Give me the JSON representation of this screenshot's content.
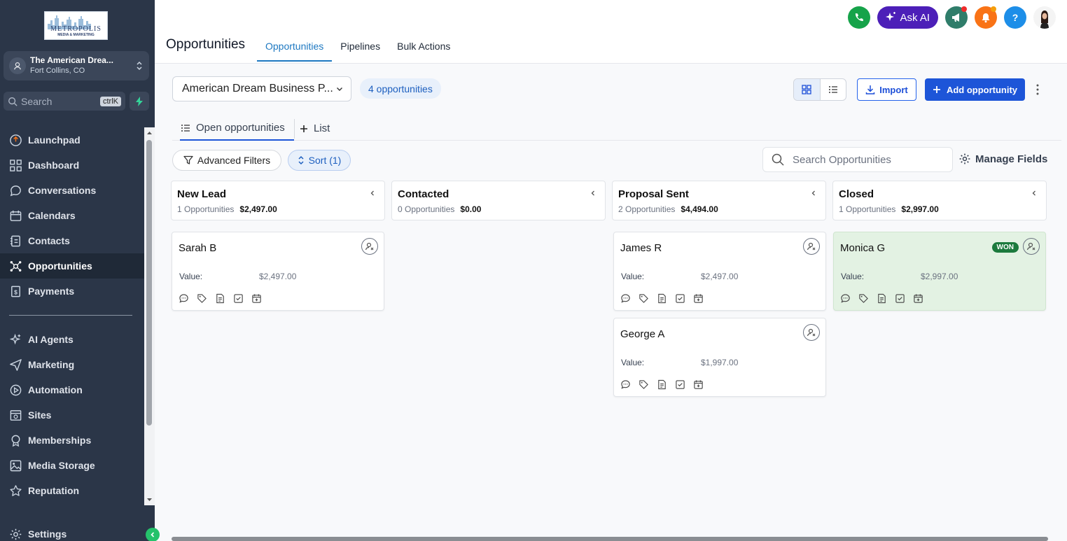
{
  "logo": {
    "line1": "METROPOLIS",
    "line2": "MEDIA & MARKETING"
  },
  "account": {
    "name": "The American Drea...",
    "location": "Fort Collins, CO"
  },
  "sidebar_search": {
    "placeholder": "Search",
    "shortcut": "ctrlK"
  },
  "nav": {
    "items": [
      {
        "label": "Launchpad",
        "icon": "launchpad-icon"
      },
      {
        "label": "Dashboard",
        "icon": "dashboard-icon"
      },
      {
        "label": "Conversations",
        "icon": "chat-icon"
      },
      {
        "label": "Calendars",
        "icon": "calendar-icon"
      },
      {
        "label": "Contacts",
        "icon": "contacts-icon"
      },
      {
        "label": "Opportunities",
        "icon": "opportunities-icon",
        "active": true
      },
      {
        "label": "Payments",
        "icon": "payments-icon"
      }
    ],
    "items2": [
      {
        "label": "AI Agents",
        "icon": "sparkle-icon"
      },
      {
        "label": "Marketing",
        "icon": "send-icon"
      },
      {
        "label": "Automation",
        "icon": "automation-icon"
      },
      {
        "label": "Sites",
        "icon": "sites-icon"
      },
      {
        "label": "Memberships",
        "icon": "badge-icon"
      },
      {
        "label": "Media Storage",
        "icon": "image-icon"
      },
      {
        "label": "Reputation",
        "icon": "star-icon"
      }
    ],
    "settings": "Settings"
  },
  "header": {
    "title": "Opportunities",
    "tabs": [
      "Opportunities",
      "Pipelines",
      "Bulk Actions"
    ],
    "ask_ai": "Ask AI"
  },
  "toolbar": {
    "pipeline": "American Dream Business P...",
    "count": "4 opportunities",
    "import": "Import",
    "add": "Add opportunity"
  },
  "subtabs": {
    "open": "Open opportunities",
    "list": "List"
  },
  "filters": {
    "advanced": "Advanced Filters",
    "sort": "Sort (1)",
    "search_placeholder": "Search Opportunities",
    "manage_fields": "Manage Fields"
  },
  "columns": [
    {
      "title": "New Lead",
      "count": "1 Opportunities",
      "total": "$2,497.00"
    },
    {
      "title": "Contacted",
      "count": "0 Opportunities",
      "total": "$0.00"
    },
    {
      "title": "Proposal Sent",
      "count": "2 Opportunities",
      "total": "$4,494.00"
    },
    {
      "title": "Closed",
      "count": "1 Opportunities",
      "total": "$2,997.00"
    }
  ],
  "cards": [
    {
      "name": "Sarah B",
      "value_label": "Value:",
      "value": "$2,497.00"
    },
    {
      "name": "James R",
      "value_label": "Value:",
      "value": "$2,497.00"
    },
    {
      "name": "George A",
      "value_label": "Value:",
      "value": "$1,997.00"
    },
    {
      "name": "Monica G",
      "value_label": "Value:",
      "value": "$2,997.00",
      "badge": "WON"
    }
  ],
  "colors": {
    "sidebar": "#2b3648",
    "primary": "#1d55d8",
    "won": "#1c7a3d",
    "ask_ai": "#4c1fb8"
  }
}
